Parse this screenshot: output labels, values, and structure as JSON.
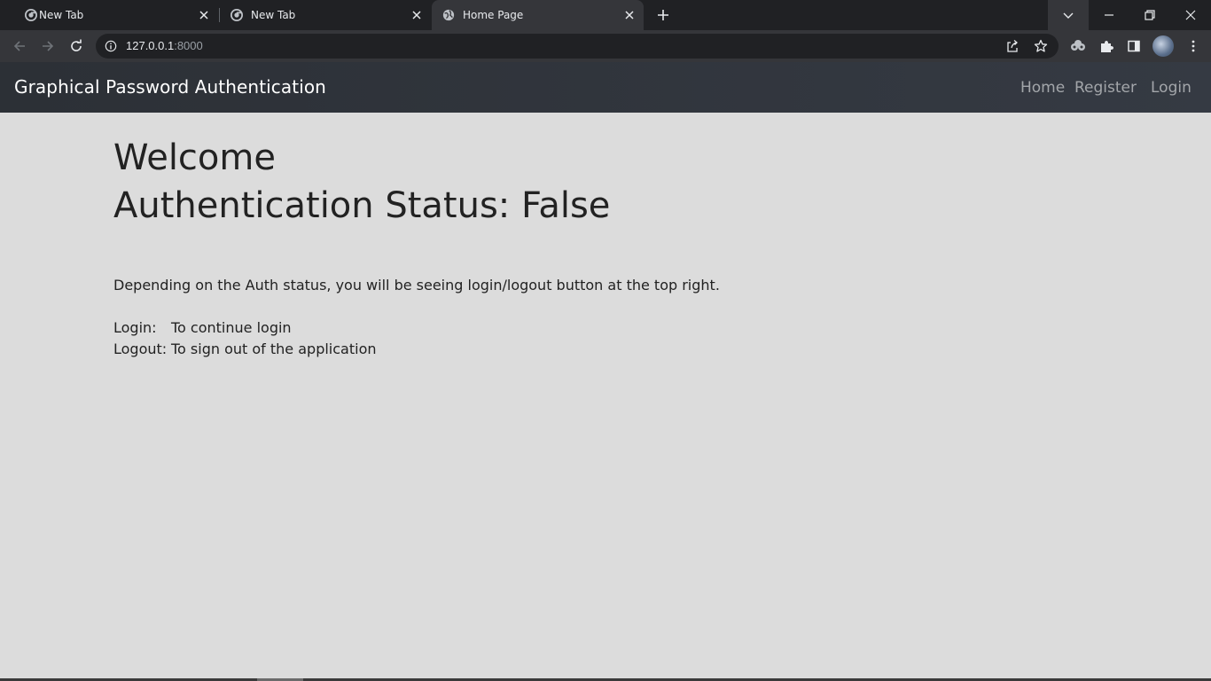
{
  "browser": {
    "tabs": [
      {
        "title": "New Tab",
        "active": false
      },
      {
        "title": "New Tab",
        "active": false
      },
      {
        "title": "Home Page",
        "active": true
      }
    ],
    "url": {
      "host": "127.0.0.1",
      "port": ":8000"
    }
  },
  "navbar": {
    "brand": "Graphical Password Authentication",
    "links": [
      "Home",
      "Register",
      "Login"
    ]
  },
  "main": {
    "welcome": "Welcome",
    "status": "Authentication Status: False",
    "description": "Depending on the Auth status, you will be seeing login/logout button at the top right.",
    "definitions": [
      {
        "term": "Login:",
        "text": "To continue login"
      },
      {
        "term": "Logout:",
        "text": "To sign out of the application"
      }
    ]
  },
  "colors": {
    "page_background": "#dcdcdc",
    "navbar_background": "#343a40",
    "nav_link": "#a3a6aa",
    "brand_text": "#ffffff"
  },
  "icons": [
    "chrome-icon",
    "globe-icon",
    "close-icon",
    "plus-icon",
    "chevron-down-icon",
    "minimize-icon",
    "restore-icon",
    "window-close-icon",
    "back-arrow-icon",
    "forward-arrow-icon",
    "reload-icon",
    "info-icon",
    "share-icon",
    "star-icon",
    "extension-icon",
    "puzzle-icon",
    "side-panel-icon",
    "menu-dots-icon"
  ]
}
